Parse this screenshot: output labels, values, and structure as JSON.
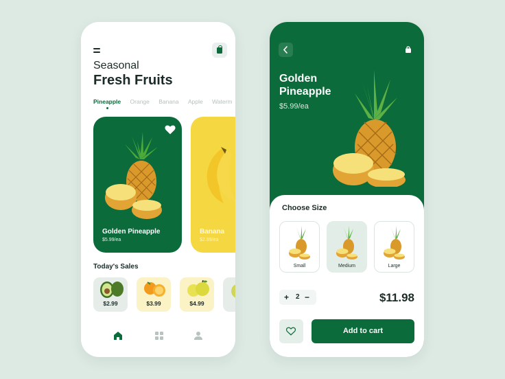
{
  "colors": {
    "primary": "#0b6b3a",
    "banana": "#f5d742",
    "background": "#dde9e3"
  },
  "left": {
    "title_light": "Seasonal",
    "title_bold": "Fresh Fruits",
    "categories": [
      "Pineapple",
      "Orange",
      "Banana",
      "Apple",
      "Waterm"
    ],
    "active_category": "Pineapple",
    "cards": [
      {
        "name": "Golden Pineapple",
        "price": "$5.99/ea"
      },
      {
        "name": "Banana",
        "price": "$2.99/ea"
      }
    ],
    "sales_title": "Today's Sales",
    "sales": [
      {
        "fruit": "avocado",
        "price": "$2.99"
      },
      {
        "fruit": "orange",
        "price": "$3.99"
      },
      {
        "fruit": "apple",
        "price": "$4.99"
      },
      {
        "fruit": "pear",
        "price": "$"
      }
    ],
    "nav": [
      "home-icon",
      "grid-icon",
      "profile-icon"
    ]
  },
  "right": {
    "title": "Golden Pineapple",
    "price": "$5.99/ea",
    "choose_size": "Choose Size",
    "sizes": [
      "Small",
      "Medium",
      "Large"
    ],
    "selected_size": "Medium",
    "quantity": "2",
    "total": "$11.98",
    "add_to_cart": "Add to cart"
  }
}
